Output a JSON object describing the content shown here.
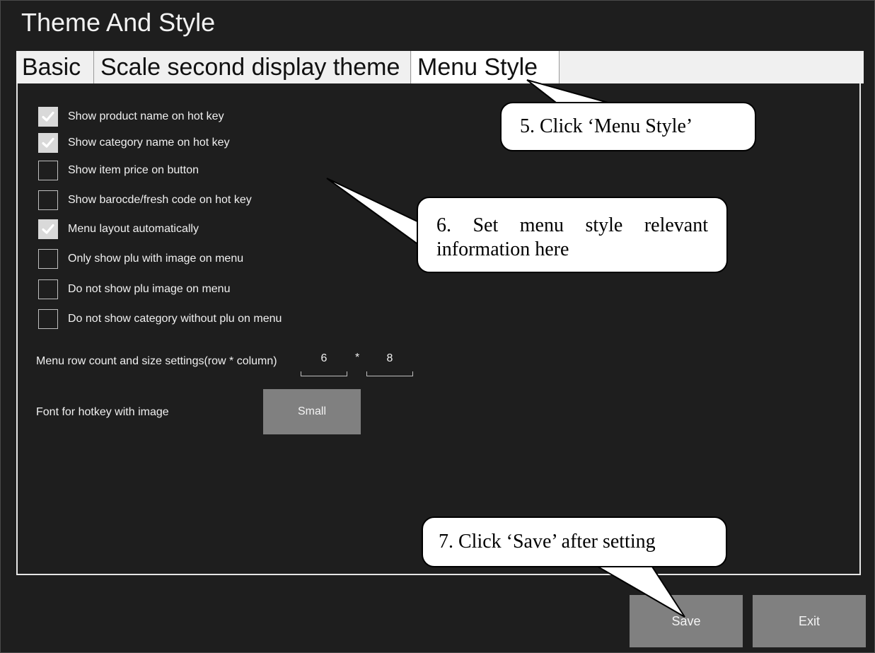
{
  "window": {
    "title": "Theme And Style"
  },
  "tabs": [
    {
      "label": "Basic"
    },
    {
      "label": "Scale second display theme"
    },
    {
      "label": "Menu Style",
      "active": true
    }
  ],
  "options": [
    {
      "label": "Show product name on hot key",
      "checked": true
    },
    {
      "label": "Show category name on hot key",
      "checked": true
    },
    {
      "label": "Show item price on button",
      "checked": false
    },
    {
      "label": "Show barocde/fresh code on hot key",
      "checked": false
    },
    {
      "label": "Menu layout automatically",
      "checked": true
    },
    {
      "label": "Only show plu with image on menu",
      "checked": false
    },
    {
      "label": "Do not show plu image on menu",
      "checked": false
    },
    {
      "label": "Do not show category without plu on menu",
      "checked": false
    }
  ],
  "menu_size": {
    "label": "Menu row count and size settings(row * column)",
    "rows": "6",
    "times": "*",
    "columns": "8"
  },
  "hotkey_font": {
    "label": "Font for hotkey with image",
    "value": "Small"
  },
  "footer": {
    "save_label": "Save",
    "exit_label": "Exit"
  },
  "annotations": {
    "step5": "5. Click ‘Menu Style’",
    "step6_line1": [
      "6.",
      "Set",
      "menu",
      "style",
      "relevant"
    ],
    "step6_line2": "information here",
    "step7": "7. Click ‘Save’ after setting"
  },
  "colors": {
    "background": "#1e1e1e",
    "tab_bar": "#f0f0f0",
    "button": "#808080",
    "checkbox_on": "#d9d9d9"
  },
  "icons": {
    "checkbox_checked": "checkmark-icon"
  }
}
